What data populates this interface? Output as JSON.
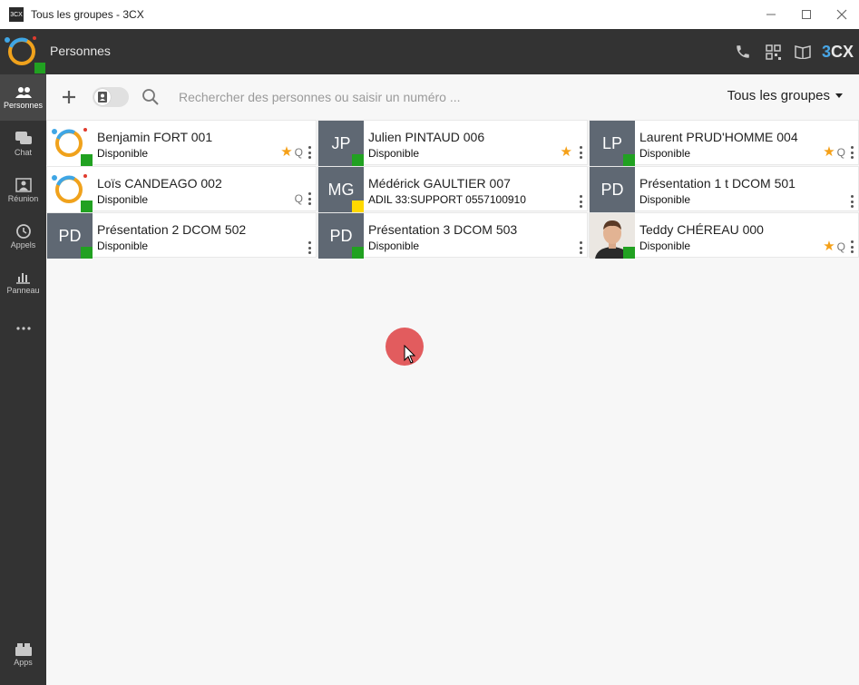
{
  "window": {
    "title": "Tous les groupes - 3CX",
    "logo_text": "3CX",
    "controls": [
      "minimize",
      "maximize",
      "close"
    ]
  },
  "appbar": {
    "title": "Personnes",
    "brand": "3CX"
  },
  "sidebar": {
    "items": [
      {
        "label": "Personnes",
        "icon": "people-icon",
        "active": true
      },
      {
        "label": "Chat",
        "icon": "chat-icon"
      },
      {
        "label": "Réunion",
        "icon": "meeting-icon"
      },
      {
        "label": "Appels",
        "icon": "history-icon"
      },
      {
        "label": "Panneau",
        "icon": "panel-icon"
      },
      {
        "label": "",
        "icon": "more-icon"
      }
    ],
    "apps_label": "Apps"
  },
  "toolbar": {
    "search_placeholder": "Rechercher des personnes ou saisir un numéro ...",
    "group_select": "Tous les groupes"
  },
  "contacts": [
    {
      "name": "Benjamin FORT 001",
      "status": "Disponible",
      "avatar": "logo",
      "star": true,
      "queue": "Q"
    },
    {
      "name": "Julien PINTAUD 006",
      "status": "Disponible",
      "initials": "JP",
      "star": true,
      "queue": ""
    },
    {
      "name": "Laurent PRUD'HOMME 004",
      "status": "Disponible",
      "initials": "LP",
      "star": true,
      "queue": "Q"
    },
    {
      "name": "Loïs CANDEAGO 002",
      "status": "Disponible",
      "avatar": "logo",
      "star": false,
      "queue": "Q"
    },
    {
      "name": "Médérick GAULTIER 007",
      "status": "ADIL 33:SUPPORT 0557100910",
      "initials": "MG",
      "presence": "away",
      "star": false,
      "queue": ""
    },
    {
      "name": "Présentation 1 t DCOM 501",
      "status": "Disponible",
      "initials": "PD",
      "star": false,
      "queue": ""
    },
    {
      "name": "Présentation 2 DCOM 502",
      "status": "Disponible",
      "initials": "PD",
      "star": false,
      "queue": ""
    },
    {
      "name": "Présentation 3 DCOM 503",
      "status": "Disponible",
      "initials": "PD",
      "star": false,
      "queue": ""
    },
    {
      "name": "Teddy CHÉREAU 000",
      "status": "Disponible",
      "avatar": "photo",
      "star": true,
      "queue": "Q"
    }
  ],
  "colors": {
    "available": "#21a121",
    "away": "#ffd900",
    "star": "#f5a017",
    "sidebar": "#333333"
  }
}
